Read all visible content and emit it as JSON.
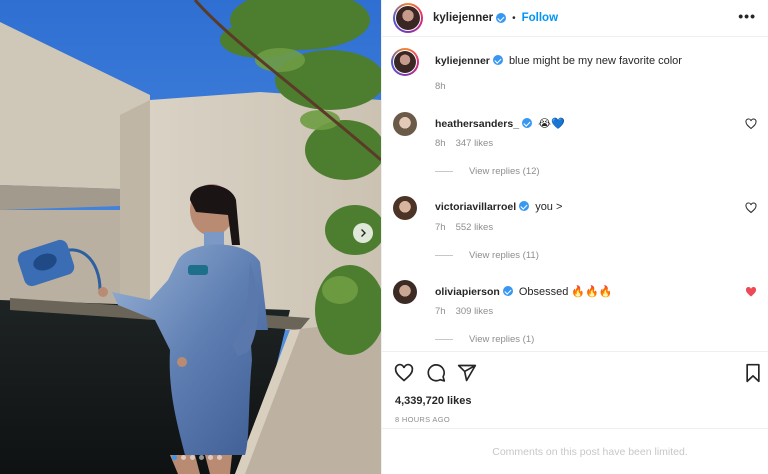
{
  "post": {
    "username": "kyliejenner",
    "separator": "•",
    "follow_label": "Follow",
    "more_icon": "more-horizontal-icon",
    "caption": {
      "username": "kyliejenner",
      "text": "blue might be my new favorite color",
      "time": "8h"
    },
    "comments": [
      {
        "username": "heathersanders_",
        "text": "😭💙",
        "time": "8h",
        "likes": "347 likes",
        "replies": "View replies (12)",
        "liked": false
      },
      {
        "username": "victoriavillarroel",
        "text": "you >",
        "time": "7h",
        "likes": "552 likes",
        "replies": "View replies (11)",
        "liked": false
      },
      {
        "username": "oliviapierson",
        "text": "Obsessed 🔥🔥🔥",
        "time": "7h",
        "likes": "309 likes",
        "replies": "View replies (1)",
        "liked": true
      }
    ],
    "likes": "4,339,720 likes",
    "posted_ago": "8 HOURS AGO",
    "comments_limited": "Comments on this post have been limited."
  },
  "carousel": {
    "slides": 6,
    "active_index": 0
  },
  "colors": {
    "accent": "#0095f6",
    "like_red": "#ed4956",
    "muted": "#8e8e8e"
  }
}
